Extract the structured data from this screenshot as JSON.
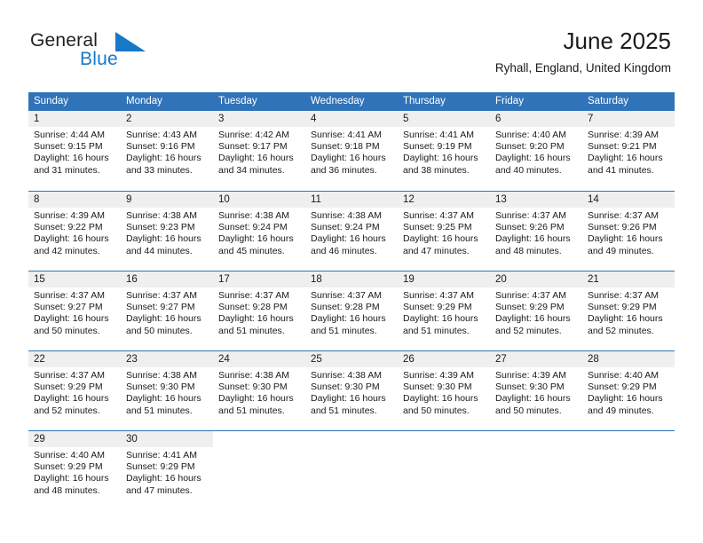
{
  "brand": {
    "name_part1": "General",
    "name_part2": "Blue",
    "mark": "triangle-logo-icon"
  },
  "header": {
    "title": "June 2025",
    "subtitle": "Ryhall, England, United Kingdom"
  },
  "colors": {
    "header_blue": "#3173b8",
    "day_strip_gray": "#efefef",
    "brand_blue": "#1878c8",
    "text": "#1a1a1a"
  },
  "weekdays": [
    "Sunday",
    "Monday",
    "Tuesday",
    "Wednesday",
    "Thursday",
    "Friday",
    "Saturday"
  ],
  "weeks": [
    [
      {
        "day": "1",
        "sunrise": "Sunrise: 4:44 AM",
        "sunset": "Sunset: 9:15 PM",
        "daylight1": "Daylight: 16 hours",
        "daylight2": "and 31 minutes."
      },
      {
        "day": "2",
        "sunrise": "Sunrise: 4:43 AM",
        "sunset": "Sunset: 9:16 PM",
        "daylight1": "Daylight: 16 hours",
        "daylight2": "and 33 minutes."
      },
      {
        "day": "3",
        "sunrise": "Sunrise: 4:42 AM",
        "sunset": "Sunset: 9:17 PM",
        "daylight1": "Daylight: 16 hours",
        "daylight2": "and 34 minutes."
      },
      {
        "day": "4",
        "sunrise": "Sunrise: 4:41 AM",
        "sunset": "Sunset: 9:18 PM",
        "daylight1": "Daylight: 16 hours",
        "daylight2": "and 36 minutes."
      },
      {
        "day": "5",
        "sunrise": "Sunrise: 4:41 AM",
        "sunset": "Sunset: 9:19 PM",
        "daylight1": "Daylight: 16 hours",
        "daylight2": "and 38 minutes."
      },
      {
        "day": "6",
        "sunrise": "Sunrise: 4:40 AM",
        "sunset": "Sunset: 9:20 PM",
        "daylight1": "Daylight: 16 hours",
        "daylight2": "and 40 minutes."
      },
      {
        "day": "7",
        "sunrise": "Sunrise: 4:39 AM",
        "sunset": "Sunset: 9:21 PM",
        "daylight1": "Daylight: 16 hours",
        "daylight2": "and 41 minutes."
      }
    ],
    [
      {
        "day": "8",
        "sunrise": "Sunrise: 4:39 AM",
        "sunset": "Sunset: 9:22 PM",
        "daylight1": "Daylight: 16 hours",
        "daylight2": "and 42 minutes."
      },
      {
        "day": "9",
        "sunrise": "Sunrise: 4:38 AM",
        "sunset": "Sunset: 9:23 PM",
        "daylight1": "Daylight: 16 hours",
        "daylight2": "and 44 minutes."
      },
      {
        "day": "10",
        "sunrise": "Sunrise: 4:38 AM",
        "sunset": "Sunset: 9:24 PM",
        "daylight1": "Daylight: 16 hours",
        "daylight2": "and 45 minutes."
      },
      {
        "day": "11",
        "sunrise": "Sunrise: 4:38 AM",
        "sunset": "Sunset: 9:24 PM",
        "daylight1": "Daylight: 16 hours",
        "daylight2": "and 46 minutes."
      },
      {
        "day": "12",
        "sunrise": "Sunrise: 4:37 AM",
        "sunset": "Sunset: 9:25 PM",
        "daylight1": "Daylight: 16 hours",
        "daylight2": "and 47 minutes."
      },
      {
        "day": "13",
        "sunrise": "Sunrise: 4:37 AM",
        "sunset": "Sunset: 9:26 PM",
        "daylight1": "Daylight: 16 hours",
        "daylight2": "and 48 minutes."
      },
      {
        "day": "14",
        "sunrise": "Sunrise: 4:37 AM",
        "sunset": "Sunset: 9:26 PM",
        "daylight1": "Daylight: 16 hours",
        "daylight2": "and 49 minutes."
      }
    ],
    [
      {
        "day": "15",
        "sunrise": "Sunrise: 4:37 AM",
        "sunset": "Sunset: 9:27 PM",
        "daylight1": "Daylight: 16 hours",
        "daylight2": "and 50 minutes."
      },
      {
        "day": "16",
        "sunrise": "Sunrise: 4:37 AM",
        "sunset": "Sunset: 9:27 PM",
        "daylight1": "Daylight: 16 hours",
        "daylight2": "and 50 minutes."
      },
      {
        "day": "17",
        "sunrise": "Sunrise: 4:37 AM",
        "sunset": "Sunset: 9:28 PM",
        "daylight1": "Daylight: 16 hours",
        "daylight2": "and 51 minutes."
      },
      {
        "day": "18",
        "sunrise": "Sunrise: 4:37 AM",
        "sunset": "Sunset: 9:28 PM",
        "daylight1": "Daylight: 16 hours",
        "daylight2": "and 51 minutes."
      },
      {
        "day": "19",
        "sunrise": "Sunrise: 4:37 AM",
        "sunset": "Sunset: 9:29 PM",
        "daylight1": "Daylight: 16 hours",
        "daylight2": "and 51 minutes."
      },
      {
        "day": "20",
        "sunrise": "Sunrise: 4:37 AM",
        "sunset": "Sunset: 9:29 PM",
        "daylight1": "Daylight: 16 hours",
        "daylight2": "and 52 minutes."
      },
      {
        "day": "21",
        "sunrise": "Sunrise: 4:37 AM",
        "sunset": "Sunset: 9:29 PM",
        "daylight1": "Daylight: 16 hours",
        "daylight2": "and 52 minutes."
      }
    ],
    [
      {
        "day": "22",
        "sunrise": "Sunrise: 4:37 AM",
        "sunset": "Sunset: 9:29 PM",
        "daylight1": "Daylight: 16 hours",
        "daylight2": "and 52 minutes."
      },
      {
        "day": "23",
        "sunrise": "Sunrise: 4:38 AM",
        "sunset": "Sunset: 9:30 PM",
        "daylight1": "Daylight: 16 hours",
        "daylight2": "and 51 minutes."
      },
      {
        "day": "24",
        "sunrise": "Sunrise: 4:38 AM",
        "sunset": "Sunset: 9:30 PM",
        "daylight1": "Daylight: 16 hours",
        "daylight2": "and 51 minutes."
      },
      {
        "day": "25",
        "sunrise": "Sunrise: 4:38 AM",
        "sunset": "Sunset: 9:30 PM",
        "daylight1": "Daylight: 16 hours",
        "daylight2": "and 51 minutes."
      },
      {
        "day": "26",
        "sunrise": "Sunrise: 4:39 AM",
        "sunset": "Sunset: 9:30 PM",
        "daylight1": "Daylight: 16 hours",
        "daylight2": "and 50 minutes."
      },
      {
        "day": "27",
        "sunrise": "Sunrise: 4:39 AM",
        "sunset": "Sunset: 9:30 PM",
        "daylight1": "Daylight: 16 hours",
        "daylight2": "and 50 minutes."
      },
      {
        "day": "28",
        "sunrise": "Sunrise: 4:40 AM",
        "sunset": "Sunset: 9:29 PM",
        "daylight1": "Daylight: 16 hours",
        "daylight2": "and 49 minutes."
      }
    ],
    [
      {
        "day": "29",
        "sunrise": "Sunrise: 4:40 AM",
        "sunset": "Sunset: 9:29 PM",
        "daylight1": "Daylight: 16 hours",
        "daylight2": "and 48 minutes."
      },
      {
        "day": "30",
        "sunrise": "Sunrise: 4:41 AM",
        "sunset": "Sunset: 9:29 PM",
        "daylight1": "Daylight: 16 hours",
        "daylight2": "and 47 minutes."
      },
      {
        "day": "",
        "sunrise": "",
        "sunset": "",
        "daylight1": "",
        "daylight2": ""
      },
      {
        "day": "",
        "sunrise": "",
        "sunset": "",
        "daylight1": "",
        "daylight2": ""
      },
      {
        "day": "",
        "sunrise": "",
        "sunset": "",
        "daylight1": "",
        "daylight2": ""
      },
      {
        "day": "",
        "sunrise": "",
        "sunset": "",
        "daylight1": "",
        "daylight2": ""
      },
      {
        "day": "",
        "sunrise": "",
        "sunset": "",
        "daylight1": "",
        "daylight2": ""
      }
    ]
  ]
}
